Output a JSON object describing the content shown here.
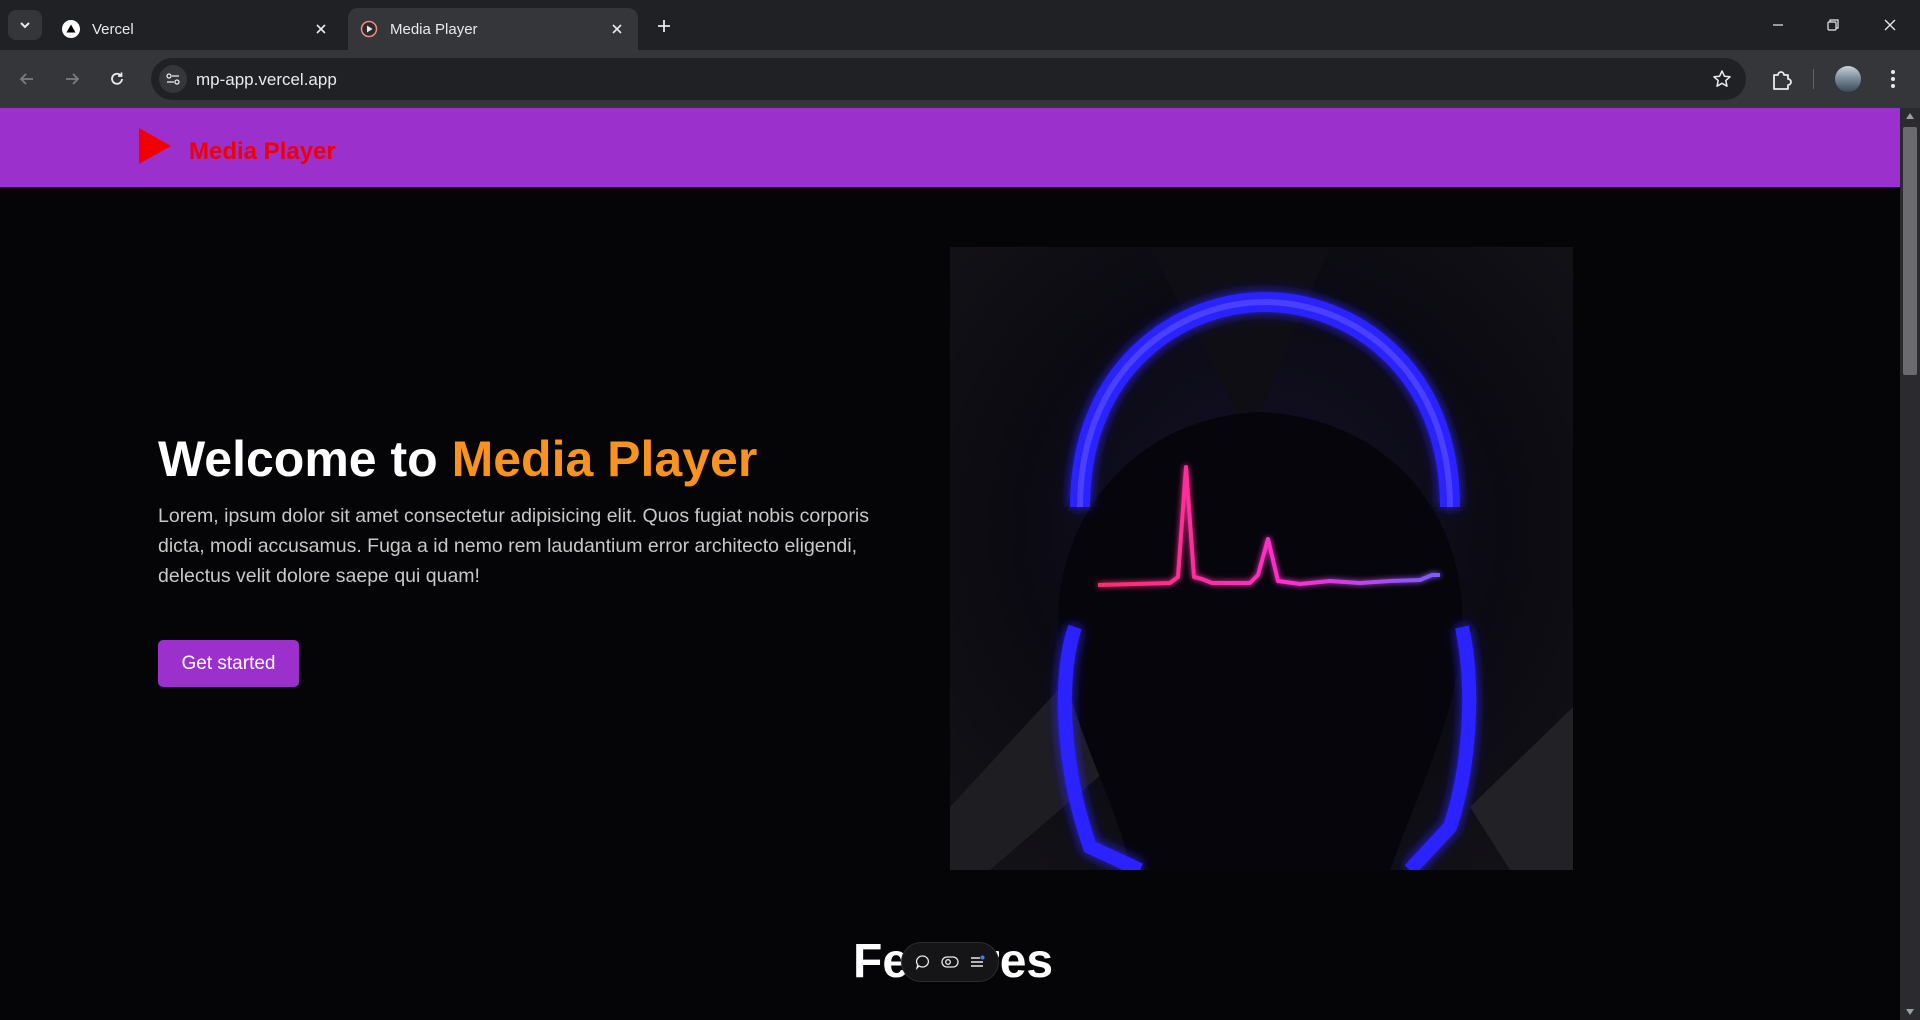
{
  "browser": {
    "tabs": [
      {
        "title": "Vercel",
        "favicon": "vercel-triangle-icon",
        "active": false
      },
      {
        "title": "Media Player",
        "favicon": "play-circle-icon",
        "active": true
      }
    ],
    "url": "mp-app.vercel.app"
  },
  "header": {
    "logo_icon": "play-triangle-icon",
    "logo_text": "Media Player",
    "background": "#9b30cc",
    "logo_color": "#f10000"
  },
  "hero": {
    "title_prefix": "Welcome to ",
    "title_accent": "Media Player",
    "accent_color": "#f7931e",
    "description": "Lorem, ipsum dolor sit amet consectetur adipisicing elit. Quos fugiat nobis corporis dicta, modi accusamus. Fuga a id nemo rem laudantium error architecto eligendi, delectus velit dolore saepe qui quam!",
    "cta_label": "Get started",
    "image": "headphones-heartbeat-illustration"
  },
  "features": {
    "title": "Features"
  },
  "floating_toolbar": {
    "icons": [
      "comment-icon",
      "eye-toggle-icon",
      "menu-lines-icon"
    ]
  }
}
